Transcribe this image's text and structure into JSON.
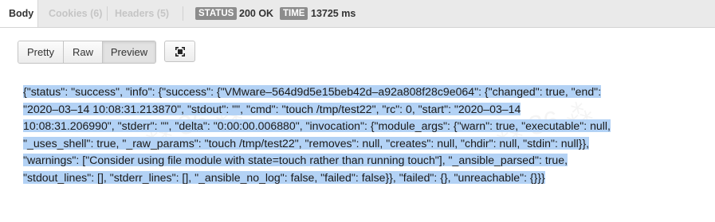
{
  "tabs": [
    {
      "label": "Body"
    },
    {
      "label": "Cookies (6)"
    },
    {
      "label": "Headers (5)"
    }
  ],
  "status": {
    "badge": "STATUS",
    "value": "200 OK"
  },
  "time": {
    "badge": "TIME",
    "value": "13725 ms"
  },
  "view_buttons": [
    {
      "label": "Pretty"
    },
    {
      "label": "Raw"
    },
    {
      "label": "Preview"
    }
  ],
  "fullscreen_icon": "fullscreen-icon",
  "response": {
    "lines": [
      "{\"status\": \"success\", \"info\": {\"success\": {\"VMware–564d9d5e15beb42d–a92a808f28c9e064\": {\"changed\": true, \"end\":",
      "\"2020–03–14 10:08:31.213870\", \"stdout\": \"\", \"cmd\": \"touch /tmp/test22\", \"rc\": 0, \"start\": \"2020–03–14",
      "10:08:31.206990\", \"stderr\": \"\", \"delta\": \"0:00:00.006880\", \"invocation\": {\"module_args\": {\"warn\": true, \"executable\": null,",
      "\"_uses_shell\": true, \"_raw_params\": \"touch /tmp/test22\", \"removes\": null, \"creates\": null, \"chdir\": null, \"stdin\": null}},",
      "\"warnings\": [\"Consider using file module with state=touch rather than running touch\"], \"_ansible_parsed\": true,",
      "\"stdout_lines\": [], \"stderr_lines\": [], \"_ansible_no_log\": false, \"failed\": false}}, \"failed\": {}, \"unreachable\": {}}}"
    ]
  },
  "colors": {
    "selection": "#b3d2f5",
    "badge_bg": "#8c8c8c"
  }
}
